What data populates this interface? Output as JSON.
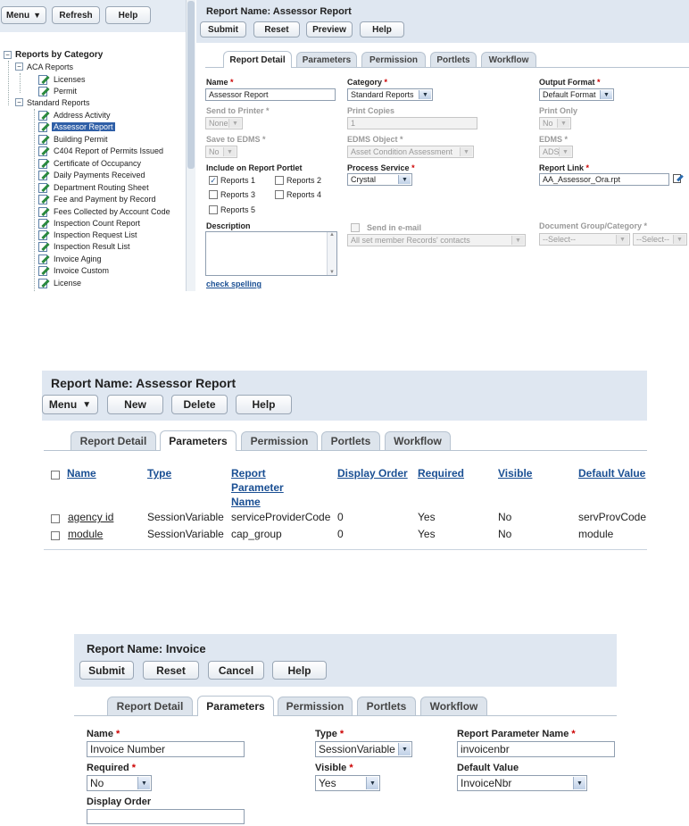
{
  "panel1": {
    "toolbar": {
      "menu": "Menu",
      "refresh": "Refresh",
      "help": "Help"
    },
    "tree": {
      "root": "Reports by Category",
      "groups": [
        {
          "label": "ACA Reports",
          "items": [
            "Licenses",
            "Permit"
          ]
        },
        {
          "label": "Standard Reports",
          "items": [
            "Address Activity",
            "Assessor Report",
            "Building Permit",
            "C404 Report of Permits Issued",
            "Certificate of Occupancy",
            "Daily Payments Received",
            "Department Routing Sheet",
            "Fee and Payment by Record",
            "Fees Collected by Account Code",
            "Inspection Count Report",
            "Inspection Request List",
            "Inspection Result List",
            "Invoice Aging",
            "Invoice Custom",
            "License"
          ]
        }
      ],
      "selected": "Assessor Report"
    },
    "title": "Report Name: Assessor Report",
    "buttons": {
      "submit": "Submit",
      "reset": "Reset",
      "preview": "Preview",
      "help": "Help"
    },
    "tabs": [
      "Report Detail",
      "Parameters",
      "Permission",
      "Portlets",
      "Workflow"
    ],
    "active_tab": "Report Detail",
    "form": {
      "name_label": "Name",
      "name_value": "Assessor Report",
      "category_label": "Category",
      "category_value": "Standard Reports",
      "output_format_label": "Output Format",
      "output_format_value": "Default Format",
      "send_to_printer_label": "Send to Printer",
      "send_to_printer_value": "None",
      "print_copies_label": "Print Copies",
      "print_copies_value": "1",
      "print_only_label": "Print Only",
      "print_only_value": "No",
      "save_to_edms_label": "Save to EDMS",
      "save_to_edms_value": "No",
      "edms_object_label": "EDMS Object",
      "edms_object_value": "Asset Condition Assessment",
      "edms_label": "EDMS",
      "edms_value": "ADS",
      "portlet_label": "Include on Report Portlet",
      "portlets": [
        {
          "label": "Reports 1",
          "checked": true
        },
        {
          "label": "Reports 2",
          "checked": false
        },
        {
          "label": "Reports 3",
          "checked": false
        },
        {
          "label": "Reports 4",
          "checked": false
        },
        {
          "label": "Reports 5",
          "checked": false
        }
      ],
      "process_service_label": "Process Service",
      "process_service_value": "Crystal",
      "report_link_label": "Report Link",
      "report_link_value": "AA_Assessor_Ora.rpt",
      "description_label": "Description",
      "description_value": "",
      "send_email_label": "Send in e-mail",
      "email_recipients_value": "All set member Records' contacts",
      "doc_group_label": "Document Group/Category",
      "doc_group_value": "--Select--",
      "doc_category_value": "--Select--",
      "check_spelling": "check spelling"
    }
  },
  "panel2": {
    "title": "Report Name: Assessor Report",
    "buttons": {
      "menu": "Menu",
      "new": "New",
      "delete": "Delete",
      "help": "Help"
    },
    "tabs": [
      "Report Detail",
      "Parameters",
      "Permission",
      "Portlets",
      "Workflow"
    ],
    "active_tab": "Parameters",
    "columns": [
      "Name",
      "Type",
      "Report Parameter Name",
      "Display Order",
      "Required",
      "Visible",
      "Default Value"
    ],
    "rows": [
      {
        "name": "agency id",
        "type": "SessionVariable",
        "param": "serviceProviderCode",
        "order": "0",
        "required": "Yes",
        "visible": "No",
        "default": "servProvCode"
      },
      {
        "name": "module",
        "type": "SessionVariable",
        "param": "cap_group",
        "order": "0",
        "required": "Yes",
        "visible": "No",
        "default": "module"
      }
    ]
  },
  "panel3": {
    "title": "Report Name: Invoice",
    "buttons": {
      "submit": "Submit",
      "reset": "Reset",
      "cancel": "Cancel",
      "help": "Help"
    },
    "tabs": [
      "Report Detail",
      "Parameters",
      "Permission",
      "Portlets",
      "Workflow"
    ],
    "active_tab": "Parameters",
    "form": {
      "name_label": "Name",
      "name_value": "Invoice Number",
      "type_label": "Type",
      "type_value": "SessionVariable",
      "param_label": "Report Parameter Name",
      "param_value": "invoicenbr",
      "required_label": "Required",
      "required_value": "No",
      "visible_label": "Visible",
      "visible_value": "Yes",
      "default_label": "Default Value",
      "default_value": "InvoiceNbr",
      "order_label": "Display Order",
      "order_value": ""
    }
  },
  "colors": {
    "header_bg": "#dfe7f1",
    "selected_bg": "#2f5fa7",
    "link": "#1a4f93",
    "required": "#cc0000"
  }
}
